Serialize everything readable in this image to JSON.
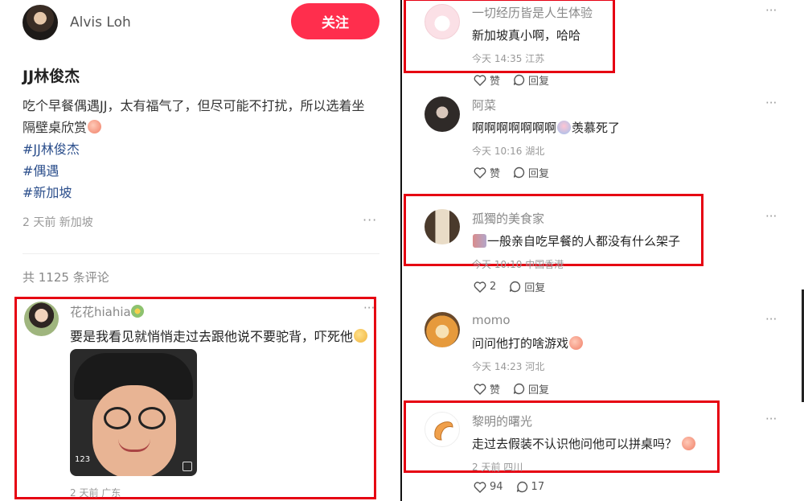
{
  "post": {
    "author_name": "Alvis Loh",
    "follow_label": "关注",
    "title": "JJ林俊杰",
    "desc": "吃个早餐偶遇JJ，太有福气了，但尽可能不打扰，所以选着坐隔壁桌欣赏",
    "tags": [
      "#JJ林俊杰",
      "#偶遇",
      "#新加坡"
    ],
    "meta": "2 天前 新加坡",
    "more": "···",
    "comment_count": "共 1125 条评论"
  },
  "left_comment": {
    "name": "花花hiahia",
    "text": "要是我看见就悄悄走过去跟他说不要驼背，吓死他",
    "photo_badge": "123",
    "meta": "2 天前 广东",
    "more": "···"
  },
  "comments": [
    {
      "name": "一切经历皆是人生体验",
      "text": "新加坡真小啊，哈哈",
      "meta": "今天 14:35 江苏",
      "like": "赞",
      "reply": "回复",
      "more": "···"
    },
    {
      "name": "阿菜",
      "text": "啊啊啊啊啊啊啊",
      "text_after": "羡慕死了",
      "meta": "今天 10:16 湖北",
      "like": "赞",
      "reply": "回复",
      "more": "···"
    },
    {
      "name": "孤獨的美食家",
      "text": "一般亲自吃早餐的人都没有什么架子",
      "meta": "今天 10:10 中国香港",
      "like": "2",
      "reply": "回复",
      "more": "···"
    },
    {
      "name": "momo",
      "text": "问问他打的啥游戏",
      "meta": "今天 14:23 河北",
      "like": "赞",
      "reply": "回复",
      "more": "···"
    },
    {
      "name": "黎明的曙光",
      "text": "走过去假装不认识他问他可以拼桌吗？",
      "meta": "2 天前 四川",
      "like": "94",
      "reply": "17",
      "more": "···"
    }
  ],
  "colors": {
    "follow_button": "#ff2e4d",
    "highlight_border": "#e60012",
    "hashtag": "#2c4f8c"
  }
}
